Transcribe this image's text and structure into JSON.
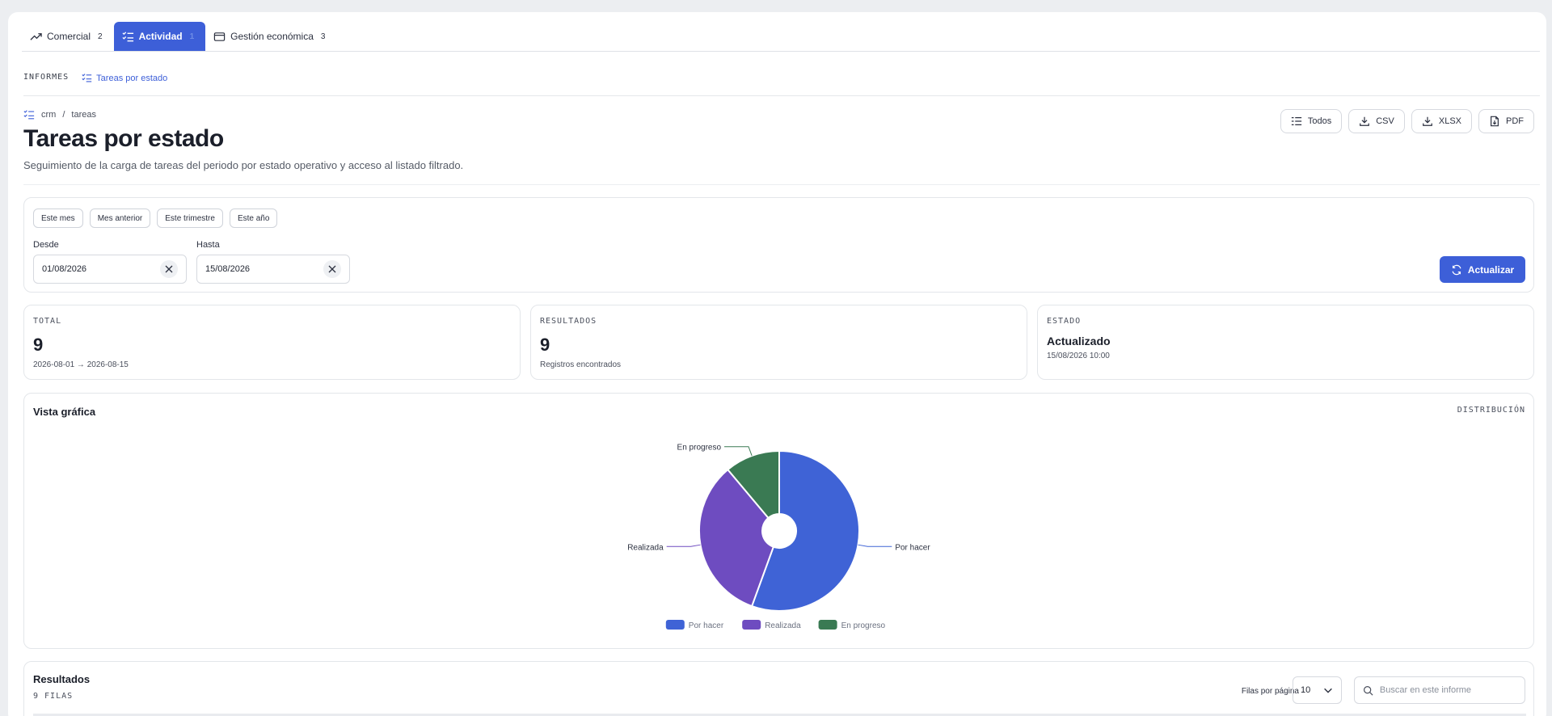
{
  "tabs": [
    {
      "label": "Comercial",
      "count": "2",
      "icon": "trending-up-icon"
    },
    {
      "label": "Actividad",
      "count": "1",
      "icon": "list-check-icon"
    },
    {
      "label": "Gestión económica",
      "count": "3",
      "icon": "wallet-icon"
    }
  ],
  "subnav": {
    "section": "INFORMES",
    "link": "Tareas por estado"
  },
  "breadcrumb": [
    "crm",
    "/",
    "tareas"
  ],
  "page": {
    "title": "Tareas por estado",
    "description": "Seguimiento de la carga de tareas del periodo por estado operativo y acceso al listado filtrado."
  },
  "exports": [
    {
      "label": "Todos",
      "icon": "list-icon"
    },
    {
      "label": "CSV",
      "icon": "download-icon"
    },
    {
      "label": "XLSX",
      "icon": "download-icon"
    },
    {
      "label": "PDF",
      "icon": "file-icon"
    }
  ],
  "filters": {
    "presets": [
      "Este mes",
      "Mes anterior",
      "Este trimestre",
      "Este año"
    ],
    "from_label": "Desde",
    "from_value": "01/08/2026",
    "to_label": "Hasta",
    "to_value": "15/08/2026",
    "refresh_label": "Actualizar"
  },
  "stats": {
    "total": {
      "label": "TOTAL",
      "value": "9",
      "sub": "2026-08-01 → 2026-08-15"
    },
    "results": {
      "label": "RESULTADOS",
      "value": "9",
      "sub": "Registros encontrados"
    },
    "status": {
      "label": "ESTADO",
      "value": "Actualizado",
      "sub": "15/08/2026 10:00"
    }
  },
  "chart_card": {
    "title": "Vista gráfica",
    "tag": "DISTRIBUCIÓN"
  },
  "chart_data": {
    "type": "pie",
    "categories": [
      "Por hacer",
      "Realizada",
      "En progreso"
    ],
    "values": [
      5,
      3,
      1
    ],
    "colors": [
      "#3f63d6",
      "#6e4cc0",
      "#3a7a53"
    ],
    "donut": true,
    "legend": "bottom"
  },
  "results": {
    "title": "Resultados",
    "rows_label": "9 FILAS",
    "per_page_label": "Filas por página",
    "per_page_value": "10",
    "search_placeholder": "Buscar en este informe"
  }
}
